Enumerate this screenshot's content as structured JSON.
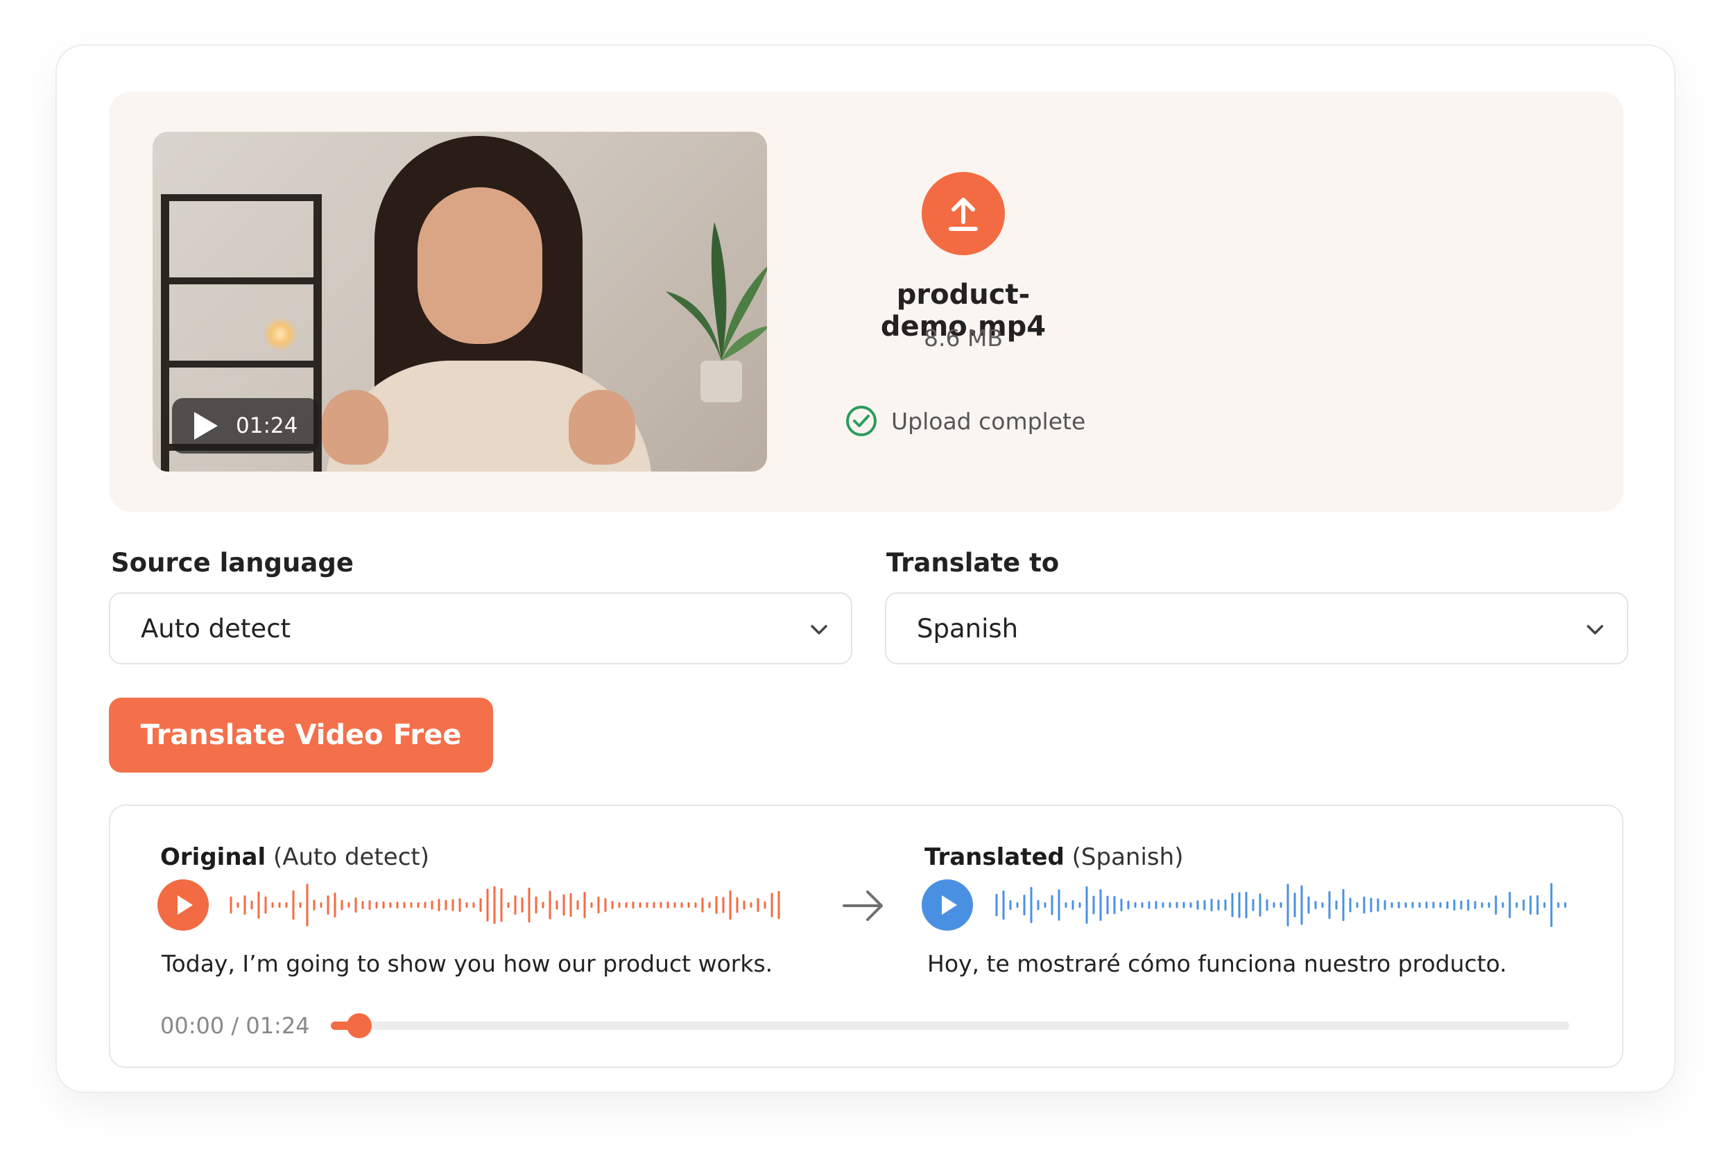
{
  "colors": {
    "accent": "#f36b42",
    "translated_accent": "#4a90e2",
    "success": "#2a9d5c"
  },
  "upload": {
    "duration": "01:24",
    "file_name": "product-demo.mp4",
    "file_size": "8.6 MB",
    "status": "Upload complete",
    "icon": "upload-arrow-icon"
  },
  "languages": {
    "source_label": "Source language",
    "source_value": "Auto detect",
    "target_label": "Translate to",
    "target_value": "Spanish"
  },
  "action": {
    "translate_label": "Translate Video Free"
  },
  "compare": {
    "original_title": "Original",
    "original_lang": "(Auto detect)",
    "original_text": "Today, I’m going to show you how our product works.",
    "translated_title": "Translated",
    "translated_lang": "(Spanish)",
    "translated_text": "Hoy, te mostraré cómo funciona nuestro producto.",
    "time_current": "00:00",
    "time_separator": "/",
    "time_total": "01:24",
    "progress_fraction": 0.013
  }
}
